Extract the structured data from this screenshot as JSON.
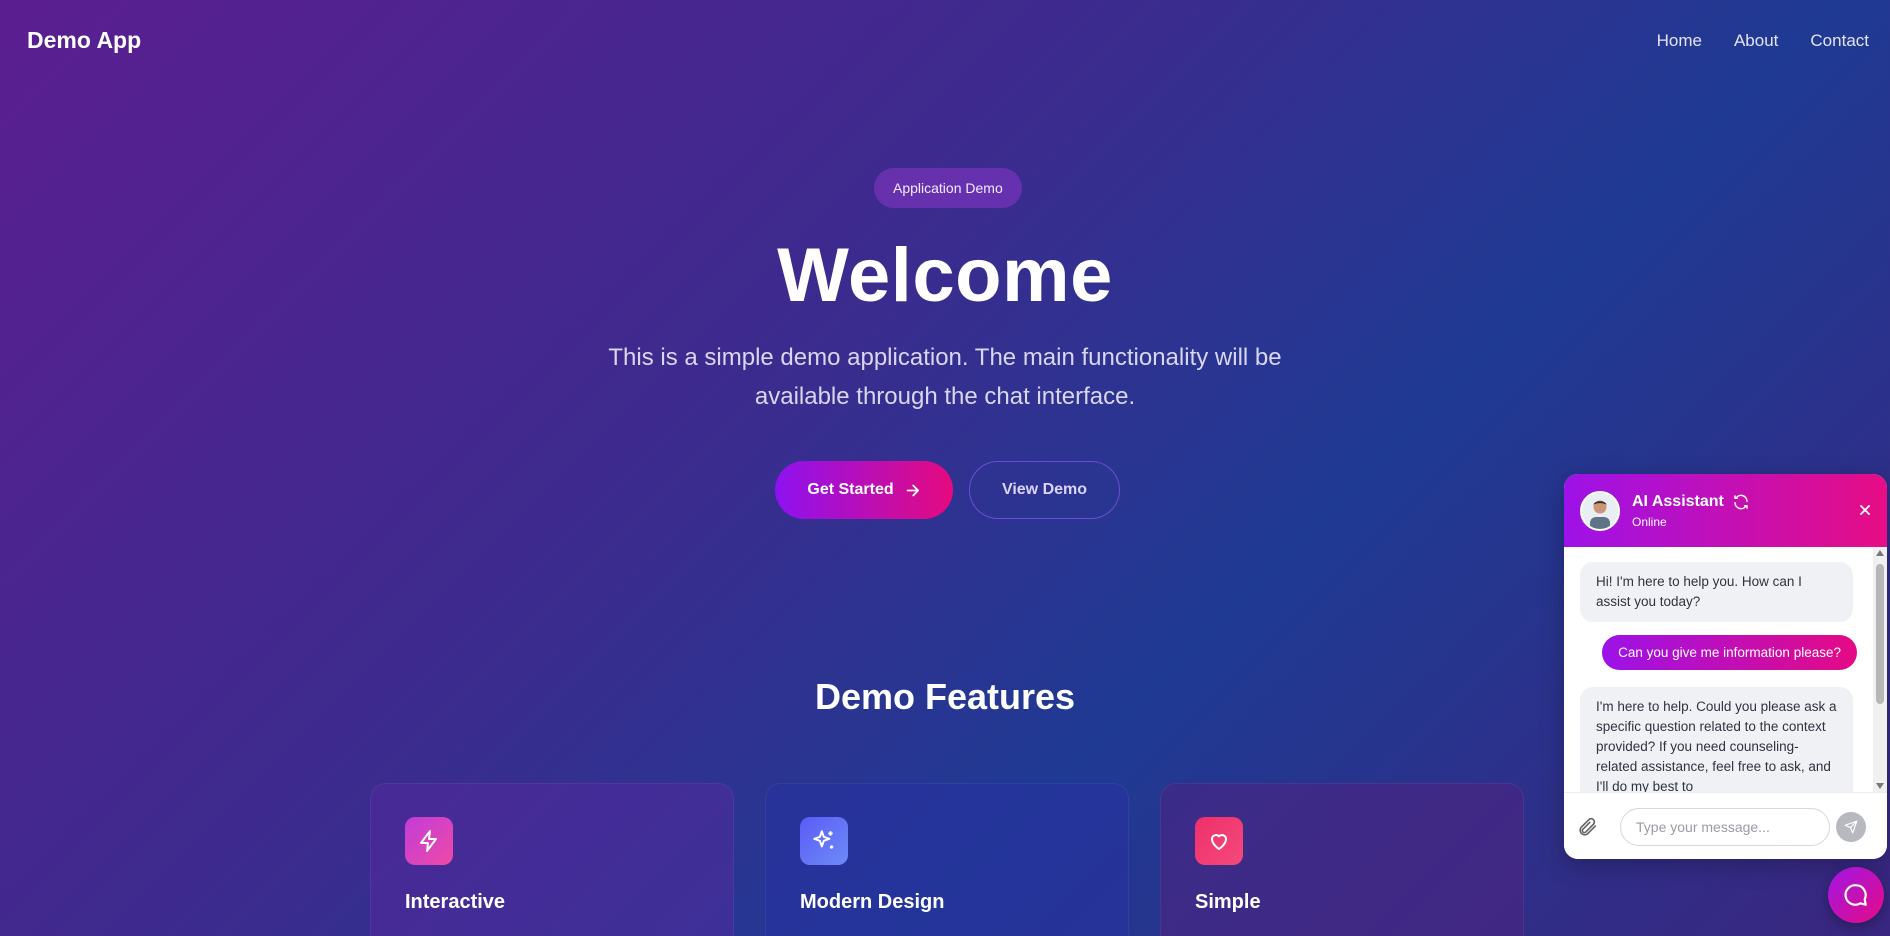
{
  "nav": {
    "brand": "Demo App",
    "links": [
      "Home",
      "About",
      "Contact"
    ]
  },
  "hero": {
    "badge": "Application Demo",
    "title": "Welcome",
    "subtitle": "This is a simple demo application. The main functionality will be available through the chat interface.",
    "primary_button": "Get Started",
    "secondary_button": "View Demo"
  },
  "features": {
    "title": "Demo Features",
    "cards": [
      {
        "title": "Interactive",
        "icon": "lightning-icon"
      },
      {
        "title": "Modern Design",
        "icon": "sparkles-icon"
      },
      {
        "title": "Simple",
        "icon": "heart-icon"
      }
    ]
  },
  "chat": {
    "name": "AI Assistant",
    "status": "Online",
    "messages": [
      {
        "role": "bot",
        "text": "Hi! I'm here to help you. How can I assist you today?"
      },
      {
        "role": "user",
        "text": "Can you give me information please?"
      },
      {
        "role": "bot",
        "text": "I'm here to help. Could you please ask a specific question related to the context provided? If you need counseling-related assistance, feel free to ask, and I'll do my best to"
      }
    ],
    "input_placeholder": "Type your message..."
  },
  "colors": {
    "accent_start": "#9d12e8",
    "accent_end": "#e70d84"
  }
}
